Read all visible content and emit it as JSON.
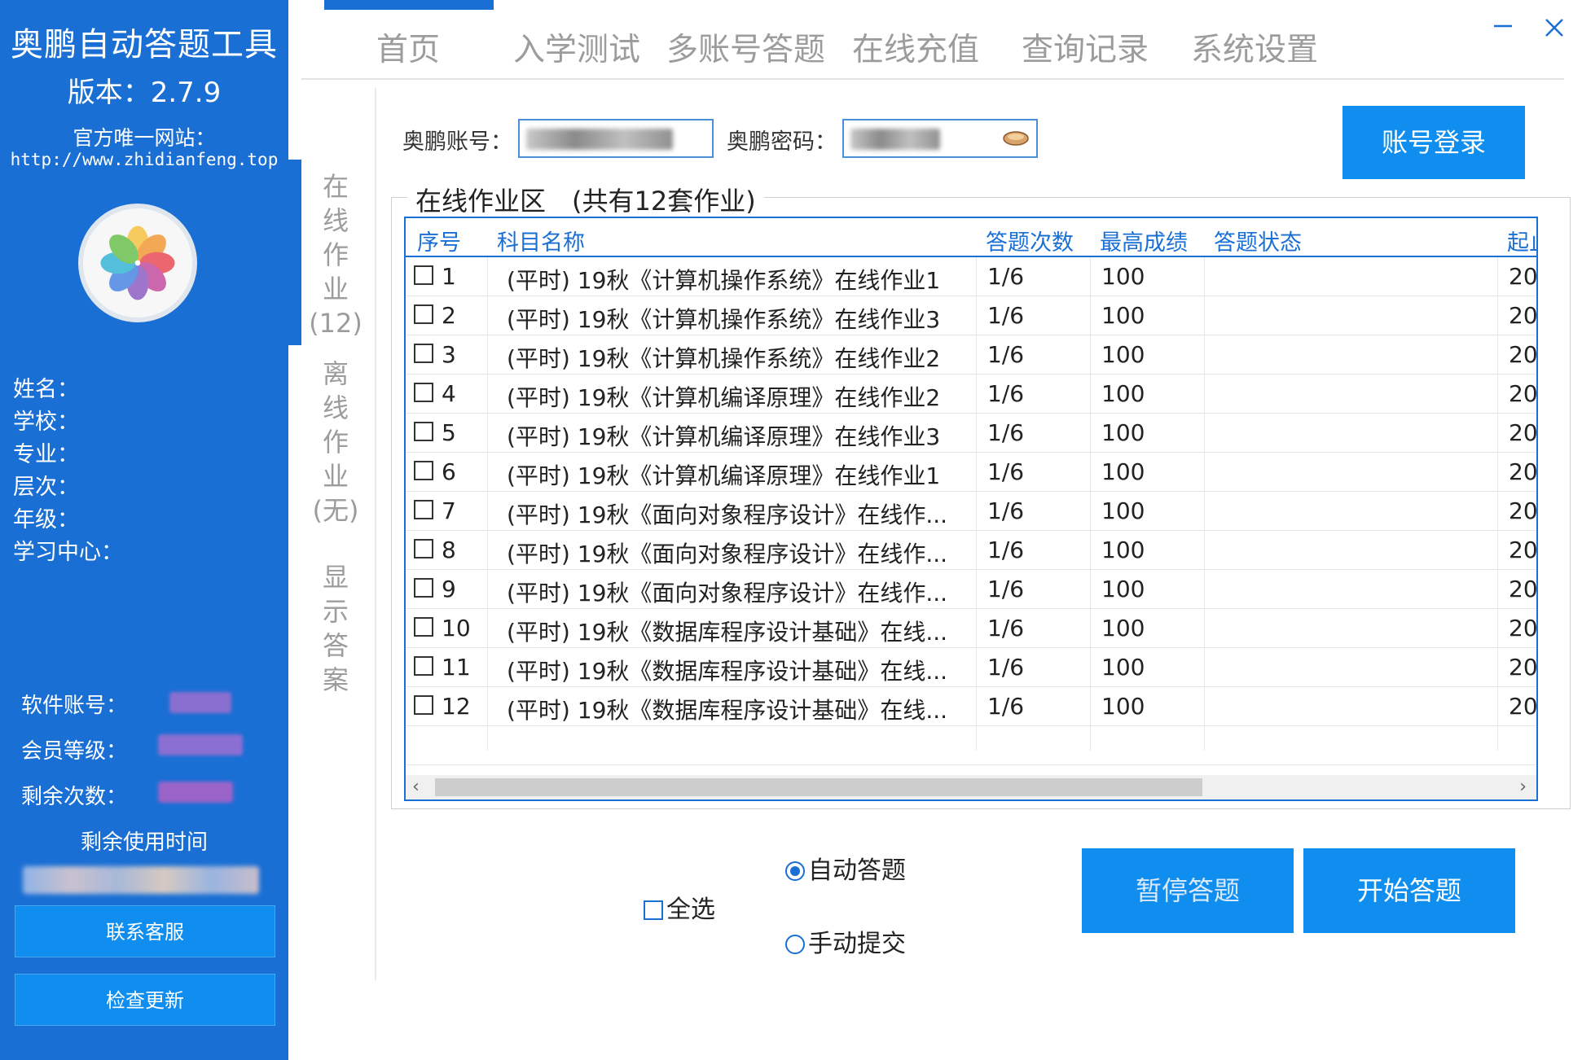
{
  "app": {
    "title": "奥鹏自动答题工具",
    "version": "版本：2.7.9",
    "site_label": "官方唯一网站：",
    "site_url": "http://www.zhidianfeng.top"
  },
  "profile": {
    "fields": [
      "姓名：",
      "学校：",
      "专业：",
      "层次：",
      "年级：",
      "学习中心："
    ]
  },
  "account": {
    "software_account_label": "软件账号：",
    "member_level_label": "会员等级：",
    "remaining_count_label": "剩余次数：",
    "remaining_time_label": "剩余使用时间"
  },
  "sidebar_buttons": {
    "contact": "联系客服",
    "update": "检查更新"
  },
  "nav": {
    "items": [
      "首页",
      "入学测试",
      "多账号答题",
      "在线充值",
      "查询记录",
      "系统设置"
    ]
  },
  "vertical_tabs": [
    {
      "chars": [
        "在",
        "线",
        "作",
        "业",
        "(12)"
      ]
    },
    {
      "chars": [
        "离",
        "线",
        "作",
        "业",
        "(无)"
      ]
    },
    {
      "chars": [
        "显",
        "示",
        "答",
        "案"
      ]
    }
  ],
  "login": {
    "account_label": "奥鹏账号：",
    "password_label": "奥鹏密码：",
    "button": "账号登录"
  },
  "homework": {
    "title": "在线作业区　(共有12套作业)",
    "columns": [
      "序号",
      "科目名称",
      "答题次数",
      "最高成绩",
      "答题状态",
      "起止"
    ],
    "rows": [
      {
        "no": "1",
        "name": "(平时) 19秋《计算机操作系统》在线作业1",
        "attempts": "1/6",
        "score": "100",
        "status": "",
        "start": "20"
      },
      {
        "no": "2",
        "name": "(平时) 19秋《计算机操作系统》在线作业3",
        "attempts": "1/6",
        "score": "100",
        "status": "",
        "start": "20"
      },
      {
        "no": "3",
        "name": "(平时) 19秋《计算机操作系统》在线作业2",
        "attempts": "1/6",
        "score": "100",
        "status": "",
        "start": "20"
      },
      {
        "no": "4",
        "name": "(平时) 19秋《计算机编译原理》在线作业2",
        "attempts": "1/6",
        "score": "100",
        "status": "",
        "start": "20"
      },
      {
        "no": "5",
        "name": "(平时) 19秋《计算机编译原理》在线作业3",
        "attempts": "1/6",
        "score": "100",
        "status": "",
        "start": "20"
      },
      {
        "no": "6",
        "name": "(平时) 19秋《计算机编译原理》在线作业1",
        "attempts": "1/6",
        "score": "100",
        "status": "",
        "start": "20"
      },
      {
        "no": "7",
        "name": "(平时) 19秋《面向对象程序设计》在线作...",
        "attempts": "1/6",
        "score": "100",
        "status": "",
        "start": "20"
      },
      {
        "no": "8",
        "name": "(平时) 19秋《面向对象程序设计》在线作...",
        "attempts": "1/6",
        "score": "100",
        "status": "",
        "start": "20"
      },
      {
        "no": "9",
        "name": "(平时) 19秋《面向对象程序设计》在线作...",
        "attempts": "1/6",
        "score": "100",
        "status": "",
        "start": "20"
      },
      {
        "no": "10",
        "name": "(平时) 19秋《数据库程序设计基础》在线...",
        "attempts": "1/6",
        "score": "100",
        "status": "",
        "start": "20"
      },
      {
        "no": "11",
        "name": "(平时) 19秋《数据库程序设计基础》在线...",
        "attempts": "1/6",
        "score": "100",
        "status": "",
        "start": "20"
      },
      {
        "no": "12",
        "name": "(平时) 19秋《数据库程序设计基础》在线...",
        "attempts": "1/6",
        "score": "100",
        "status": "",
        "start": "20"
      }
    ]
  },
  "controls": {
    "select_all": "全选",
    "auto_answer": "自动答题",
    "manual_submit": "手动提交",
    "pause": "暂停答题",
    "start": "开始答题"
  },
  "colors": {
    "brand_blue": "#1a6fd4",
    "button_blue": "#0f8ef0",
    "nav_gray": "#9c9c9c"
  }
}
